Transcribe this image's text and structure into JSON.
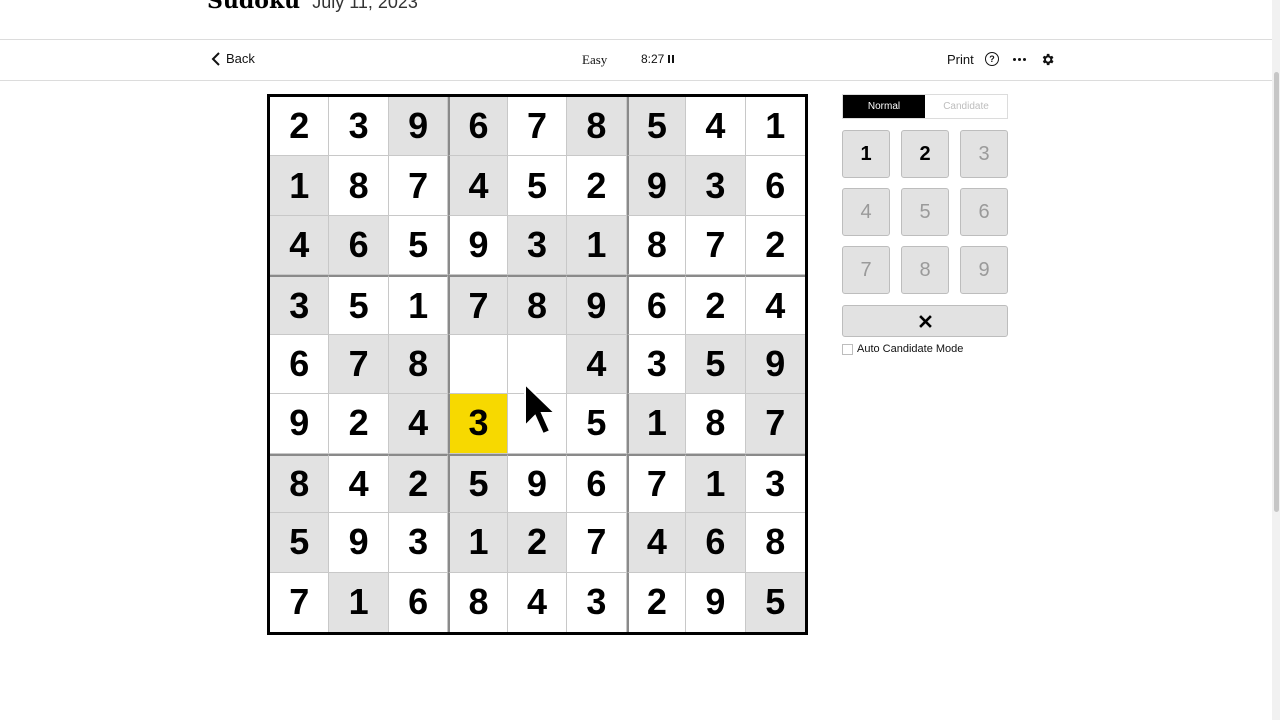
{
  "header": {
    "brand": "Sudoku",
    "date": "July 11, 2023"
  },
  "toolbar": {
    "back_label": "Back",
    "difficulty": "Easy",
    "timer": "8:27",
    "print_label": "Print",
    "help_glyph": "?"
  },
  "icons": {
    "back": "chevron-left-icon",
    "pause": "pause-icon",
    "help": "help-icon",
    "more": "more-icon",
    "settings": "gear-icon",
    "erase": "close-icon",
    "cursor": "mouse-pointer-icon"
  },
  "colors": {
    "selected_cell": "#f7d900",
    "shaded_cell": "#e2e2e2",
    "mode_active": "#000000"
  },
  "board": {
    "selected": {
      "row": 5,
      "col": 3
    },
    "rows": [
      [
        "2",
        "3",
        "9",
        "6",
        "7",
        "8",
        "5",
        "4",
        "1"
      ],
      [
        "1",
        "8",
        "7",
        "4",
        "5",
        "2",
        "9",
        "3",
        "6"
      ],
      [
        "4",
        "6",
        "5",
        "9",
        "3",
        "1",
        "8",
        "7",
        "2"
      ],
      [
        "3",
        "5",
        "1",
        "7",
        "8",
        "9",
        "6",
        "2",
        "4"
      ],
      [
        "6",
        "7",
        "8",
        "",
        "",
        "4",
        "3",
        "5",
        "9"
      ],
      [
        "9",
        "2",
        "4",
        "3",
        "",
        "5",
        "1",
        "8",
        "7"
      ],
      [
        "8",
        "4",
        "2",
        "5",
        "9",
        "6",
        "7",
        "1",
        "3"
      ],
      [
        "5",
        "9",
        "3",
        "1",
        "2",
        "7",
        "4",
        "6",
        "8"
      ],
      [
        "7",
        "1",
        "6",
        "8",
        "4",
        "3",
        "2",
        "9",
        "5"
      ]
    ],
    "shaded": [
      [
        0,
        0,
        1,
        1,
        0,
        1,
        1,
        0,
        0
      ],
      [
        1,
        0,
        0,
        1,
        0,
        0,
        1,
        1,
        0
      ],
      [
        1,
        1,
        0,
        0,
        1,
        1,
        0,
        0,
        0
      ],
      [
        1,
        0,
        0,
        1,
        1,
        1,
        0,
        0,
        0
      ],
      [
        0,
        1,
        1,
        0,
        0,
        1,
        0,
        1,
        1
      ],
      [
        0,
        0,
        1,
        0,
        0,
        0,
        1,
        0,
        1
      ],
      [
        1,
        0,
        1,
        1,
        0,
        0,
        0,
        1,
        0
      ],
      [
        1,
        0,
        0,
        1,
        1,
        0,
        1,
        1,
        0
      ],
      [
        0,
        1,
        0,
        0,
        0,
        0,
        0,
        0,
        1
      ]
    ]
  },
  "mode_toggle": {
    "normal_label": "Normal",
    "candidate_label": "Candidate",
    "active": "Normal"
  },
  "numpad": {
    "keys": [
      {
        "label": "1",
        "enabled": true
      },
      {
        "label": "2",
        "enabled": true
      },
      {
        "label": "3",
        "enabled": false
      },
      {
        "label": "4",
        "enabled": false
      },
      {
        "label": "5",
        "enabled": false
      },
      {
        "label": "6",
        "enabled": false
      },
      {
        "label": "7",
        "enabled": false
      },
      {
        "label": "8",
        "enabled": false
      },
      {
        "label": "9",
        "enabled": false
      }
    ]
  },
  "auto_candidate": {
    "label": "Auto Candidate Mode",
    "checked": false
  }
}
